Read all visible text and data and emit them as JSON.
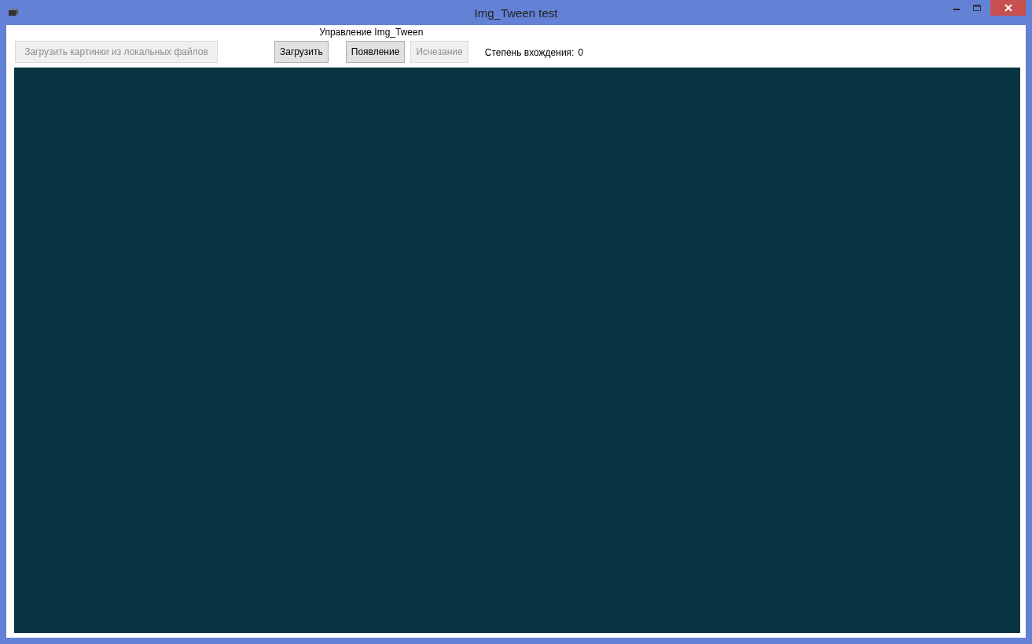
{
  "window": {
    "title": "Img_Tween test"
  },
  "load_local_button": {
    "label": "Загрузить картинки из локальных файлов",
    "disabled": true
  },
  "tween_group": {
    "caption": "Управление Img_Tween",
    "buttons": [
      {
        "label": "Загрузить",
        "disabled": false
      },
      {
        "label": "Появление",
        "disabled": false
      },
      {
        "label": "Исчезание",
        "disabled": true
      }
    ]
  },
  "degree": {
    "label": "Степень вхождения:",
    "value": "0"
  }
}
